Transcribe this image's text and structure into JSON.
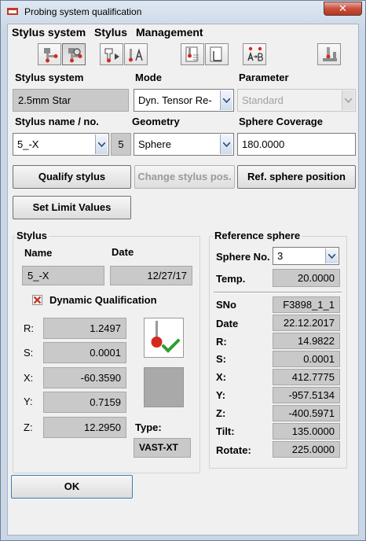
{
  "window": {
    "title": "Probing system qualification",
    "close_glyph": "✕"
  },
  "menu": [
    "Stylus system",
    "Stylus",
    "Management"
  ],
  "toolbar": {
    "icons": [
      "stylus-system-icon",
      "stylus-system-settings-icon",
      "stylus-add-icon",
      "stylus-rename-icon",
      "sphere-position-icon",
      "sphere-document-icon",
      "stylus-swap-icon",
      "machine-icon"
    ]
  },
  "form": {
    "stylus_system_label": "Stylus system",
    "stylus_system_value": "2.5mm Star",
    "mode_label": "Mode",
    "mode_value": "Dyn. Tensor Re-",
    "parameter_label": "Parameter",
    "parameter_value": "Standard",
    "stylus_name_label": "Stylus name / no.",
    "stylus_name_value": "5_-X",
    "stylus_number": "5",
    "geometry_label": "Geometry",
    "geometry_value": "Sphere",
    "coverage_label": "Sphere Coverage",
    "coverage_value": "180.0000"
  },
  "buttons": {
    "qualify": "Qualify stylus",
    "change_pos": "Change stylus pos.",
    "ref_sphere": "Ref. sphere position",
    "limits": "Set Limit Values",
    "ok": "OK"
  },
  "stylus": {
    "title": "Stylus",
    "name_label": "Name",
    "date_label": "Date",
    "name": "5_-X",
    "date": "12/27/17",
    "dynamic_label": "Dynamic Qualification",
    "dynamic_checked": true,
    "rows": [
      {
        "label": "R:",
        "value": "1.2497"
      },
      {
        "label": "S:",
        "value": "0.0001"
      },
      {
        "label": "X:",
        "value": "-60.3590"
      },
      {
        "label": "Y:",
        "value": "0.7159"
      },
      {
        "label": "Z:",
        "value": "12.2950"
      }
    ],
    "type_label": "Type:",
    "type_value": "VAST-XT"
  },
  "reference_sphere": {
    "title": "Reference sphere",
    "sphere_no_label": "Sphere No.",
    "sphere_no_value": "3",
    "temp_label": "Temp.",
    "temp_value": "20.0000",
    "rows": [
      {
        "label": "SNo",
        "value": "F3898_1_1"
      },
      {
        "label": "Date",
        "value": "22.12.2017"
      },
      {
        "label": "R:",
        "value": "14.9822"
      },
      {
        "label": "S:",
        "value": "0.0001"
      },
      {
        "label": "X:",
        "value": "412.7775"
      },
      {
        "label": "Y:",
        "value": "-957.5134"
      },
      {
        "label": "Z:",
        "value": "-400.5971"
      },
      {
        "label": "Tilt:",
        "value": "135.0000"
      },
      {
        "label": "Rotate:",
        "value": "225.0000"
      }
    ]
  },
  "colors": {
    "red": "#d42a1e",
    "check_green": "#2e9d2e",
    "readonly_bg": "#c9c9c9"
  }
}
